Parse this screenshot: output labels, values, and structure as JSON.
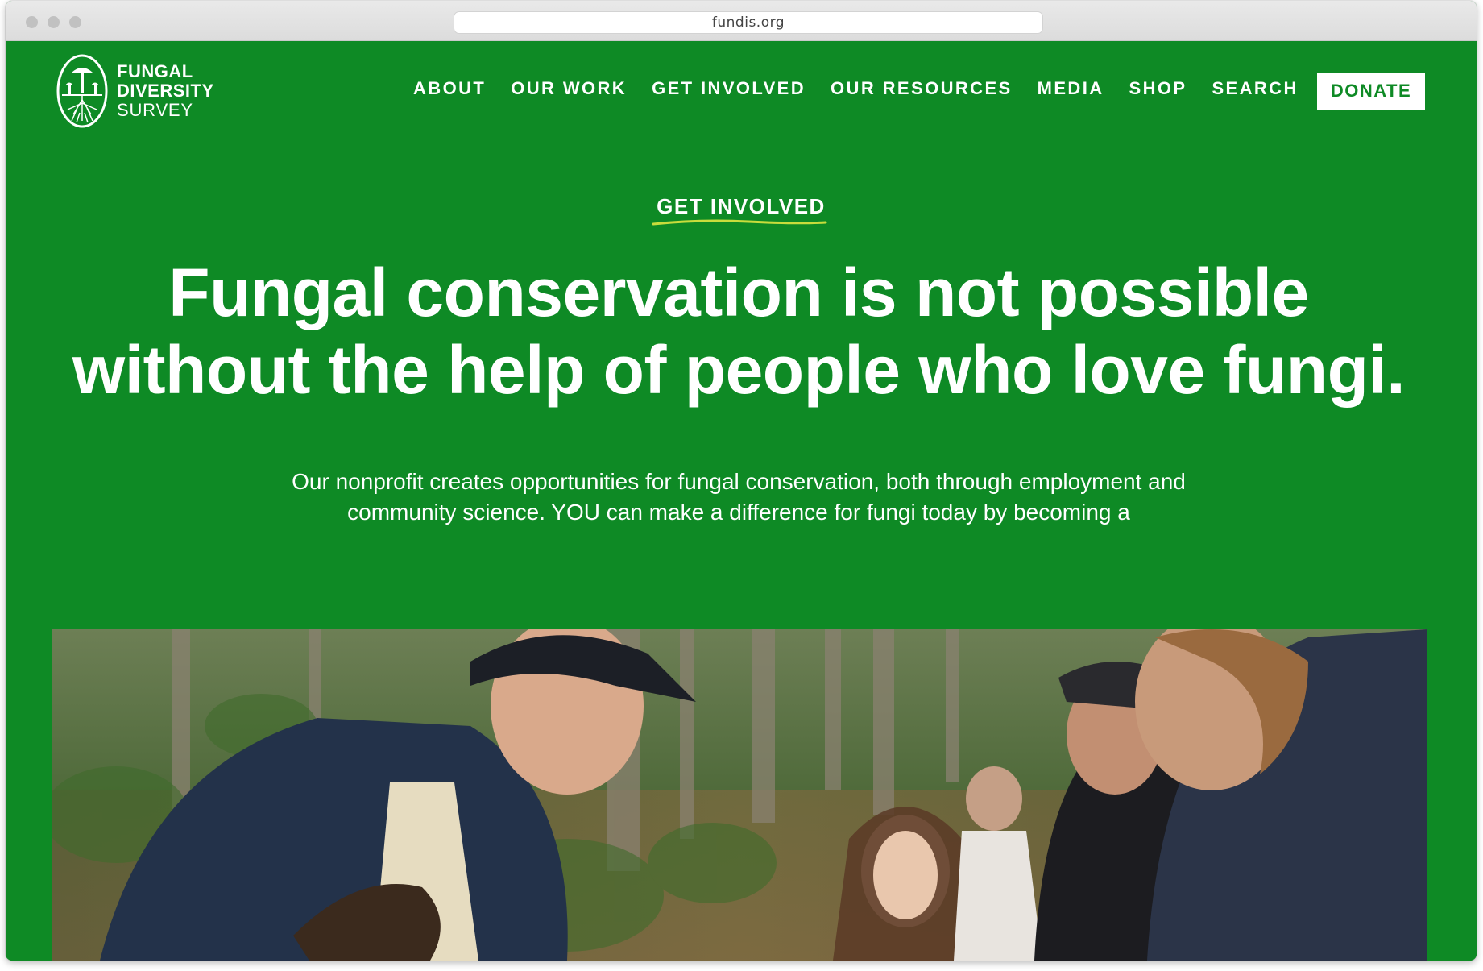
{
  "browser": {
    "url": "fundis.org"
  },
  "header": {
    "logo": {
      "line1": "FUNGAL",
      "line2": "DIVERSITY",
      "line3": "SURVEY",
      "icon": "mushroom-roots-icon"
    },
    "nav": [
      {
        "label": "ABOUT"
      },
      {
        "label": "OUR WORK"
      },
      {
        "label": "GET INVOLVED"
      },
      {
        "label": "OUR RESOURCES"
      },
      {
        "label": "MEDIA"
      },
      {
        "label": "SHOP"
      },
      {
        "label": "SEARCH"
      }
    ],
    "donate_label": "DONATE"
  },
  "hero": {
    "eyebrow": "GET INVOLVED",
    "title": "Fungal conservation is not possible without the help of people who love fungi.",
    "subtitle": "Our nonprofit creates opportunities for fungal conservation, both through employment and community science. YOU can make a difference for fungi today by becoming a"
  },
  "colors": {
    "brand_green": "#0e8a25",
    "accent_yellow": "#c8dc3c",
    "text_white": "#ffffff"
  }
}
